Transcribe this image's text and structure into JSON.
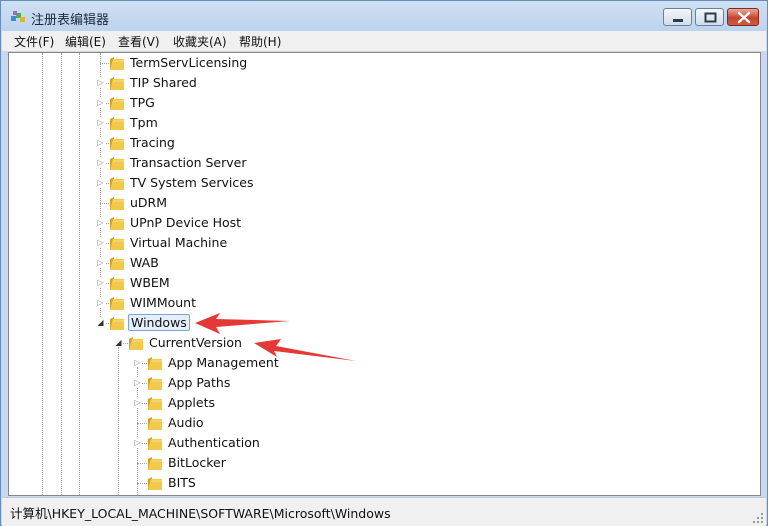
{
  "window": {
    "title": "注册表编辑器"
  },
  "menu": [
    {
      "label": "文件(F)"
    },
    {
      "label": "编辑(E)"
    },
    {
      "label": "查看(V)"
    },
    {
      "label": "收藏夹(A)"
    },
    {
      "label": "帮助(H)"
    }
  ],
  "tree": {
    "items": [
      {
        "label": "TermServLicensing",
        "level": 1,
        "expander": "none"
      },
      {
        "label": "TIP Shared",
        "level": 1,
        "expander": "collapsed"
      },
      {
        "label": "TPG",
        "level": 1,
        "expander": "collapsed"
      },
      {
        "label": "Tpm",
        "level": 1,
        "expander": "collapsed"
      },
      {
        "label": "Tracing",
        "level": 1,
        "expander": "collapsed"
      },
      {
        "label": "Transaction Server",
        "level": 1,
        "expander": "collapsed"
      },
      {
        "label": "TV System Services",
        "level": 1,
        "expander": "collapsed"
      },
      {
        "label": "uDRM",
        "level": 1,
        "expander": "none"
      },
      {
        "label": "UPnP Device Host",
        "level": 1,
        "expander": "collapsed"
      },
      {
        "label": "Virtual Machine",
        "level": 1,
        "expander": "collapsed"
      },
      {
        "label": "WAB",
        "level": 1,
        "expander": "collapsed"
      },
      {
        "label": "WBEM",
        "level": 1,
        "expander": "collapsed"
      },
      {
        "label": "WIMMount",
        "level": 1,
        "expander": "collapsed"
      },
      {
        "label": "Windows",
        "level": 1,
        "expander": "expanded",
        "selected": true
      },
      {
        "label": "CurrentVersion",
        "level": 2,
        "expander": "expanded"
      },
      {
        "label": "App Management",
        "level": 3,
        "expander": "collapsed"
      },
      {
        "label": "App Paths",
        "level": 3,
        "expander": "collapsed"
      },
      {
        "label": "Applets",
        "level": 3,
        "expander": "collapsed"
      },
      {
        "label": "Audio",
        "level": 3,
        "expander": "none"
      },
      {
        "label": "Authentication",
        "level": 3,
        "expander": "collapsed"
      },
      {
        "label": "BitLocker",
        "level": 3,
        "expander": "none"
      },
      {
        "label": "BITS",
        "level": 3,
        "expander": "none"
      }
    ]
  },
  "status": {
    "path": "计算机\\HKEY_LOCAL_MACHINE\\SOFTWARE\\Microsoft\\Windows"
  },
  "colors": {
    "folder": "#f2c94c",
    "folder_dark": "#d9a21b",
    "arrow": "#e53935",
    "selection_border": "#7da2ce"
  },
  "icons": {
    "app": "registry-icon",
    "folder": "folder-icon",
    "minimize": "minimize-icon",
    "maximize": "maximize-icon",
    "close": "close-icon"
  }
}
